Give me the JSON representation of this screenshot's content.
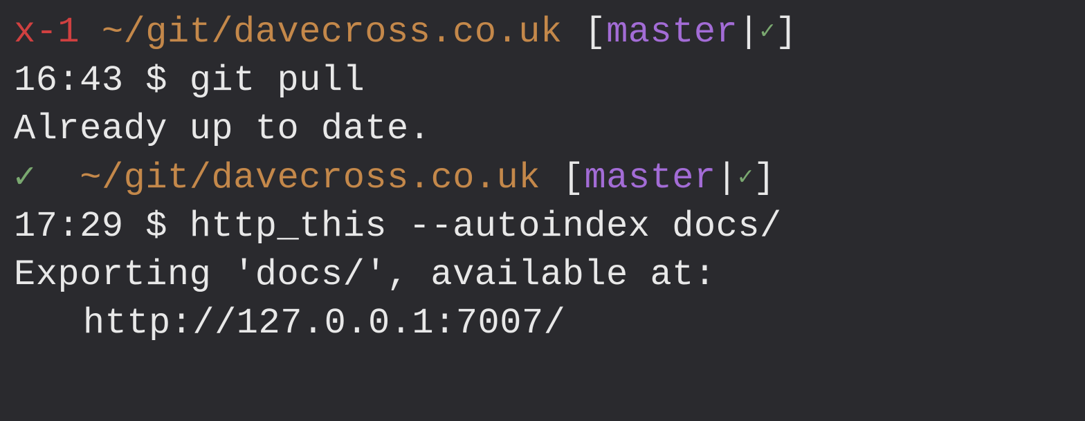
{
  "lines": [
    {
      "type": "prompt-header",
      "status": "x-1",
      "statusClass": "fail",
      "path": "~/git/davecross.co.uk",
      "branch": "master",
      "check": "✓"
    },
    {
      "type": "prompt-command",
      "time": "16:43",
      "symbol": "$",
      "command": "git pull"
    },
    {
      "type": "output",
      "text": "Already up to date."
    },
    {
      "type": "prompt-header",
      "status": "✓",
      "statusClass": "ok",
      "path": "~/git/davecross.co.uk",
      "branch": "master",
      "check": "✓"
    },
    {
      "type": "prompt-command",
      "time": "17:29",
      "symbol": "$",
      "command": "http_this --autoindex docs/"
    },
    {
      "type": "output",
      "text": "Exporting 'docs/', available at:"
    },
    {
      "type": "output-indent",
      "text": "http://127.0.0.1:7007/"
    }
  ]
}
